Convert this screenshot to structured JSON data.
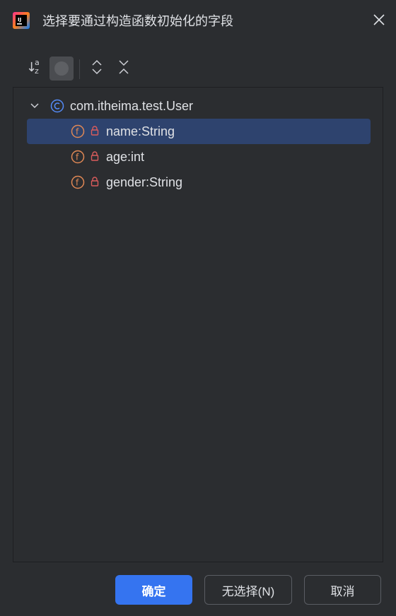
{
  "window": {
    "title": "选择要通过构造函数初始化的字段",
    "app_icon": "intellij-idea-icon",
    "close_icon": "close-icon"
  },
  "toolbar": {
    "sort_icon": "sort-alphabetically-icon",
    "sort_a": "a",
    "sort_z": "z",
    "toggle_icon": "show-fields-toggle-icon",
    "expand_icon": "expand-all-icon",
    "collapse_icon": "collapse-all-icon"
  },
  "tree": {
    "root": {
      "label": "com.itheima.test.User",
      "icon": "class-icon",
      "expanded": true
    },
    "fields": [
      {
        "label": "name:String",
        "icon": "field-icon",
        "modifier_icon": "private-lock-icon",
        "selected": true
      },
      {
        "label": "age:int",
        "icon": "field-icon",
        "modifier_icon": "private-lock-icon",
        "selected": false
      },
      {
        "label": "gender:String",
        "icon": "field-icon",
        "modifier_icon": "private-lock-icon",
        "selected": false
      }
    ]
  },
  "buttons": {
    "ok": "确定",
    "select_none": "无选择(N)",
    "cancel": "取消"
  },
  "colors": {
    "background": "#2b2d30",
    "selection": "#2e436e",
    "primary_button": "#3574f0",
    "class_icon": "#548af7",
    "field_icon": "#e08855",
    "lock_icon": "#db5c5c"
  }
}
